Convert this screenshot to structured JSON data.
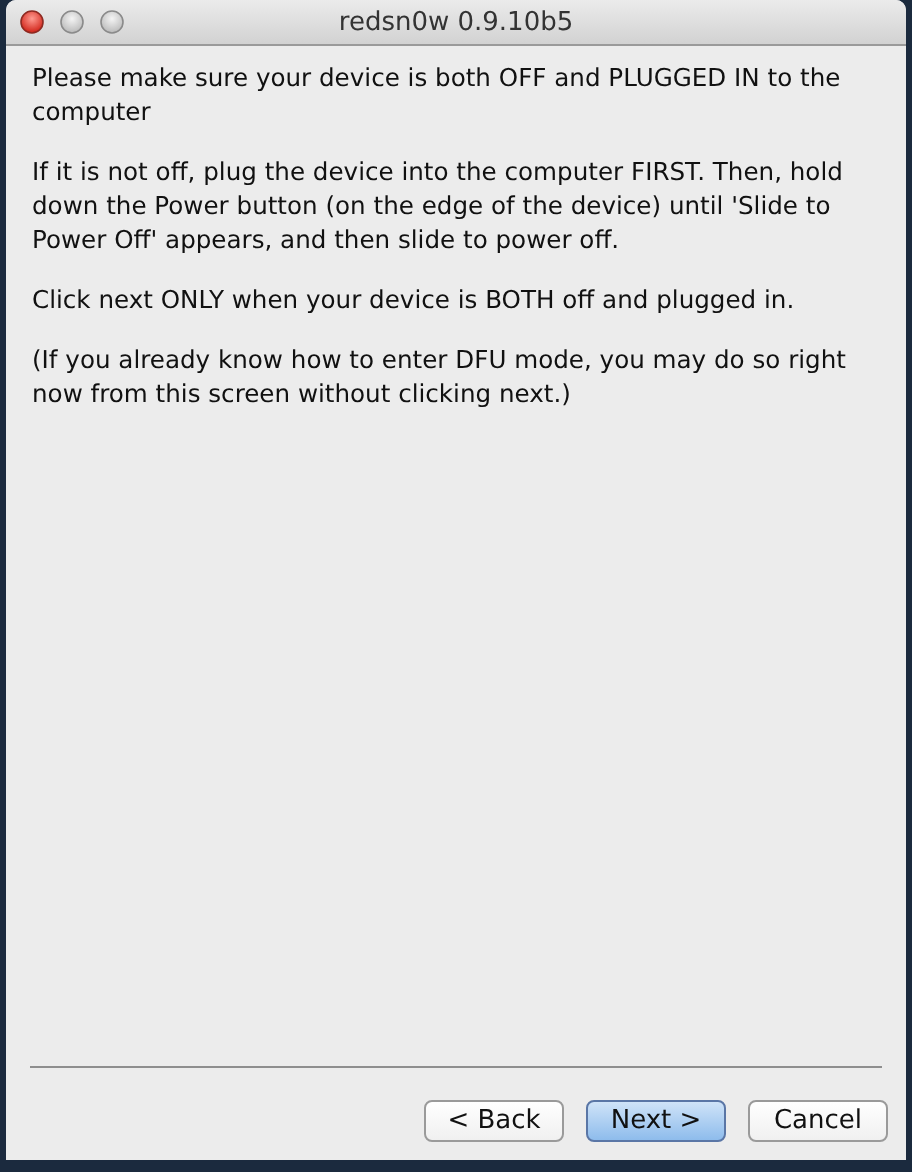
{
  "window": {
    "title": "redsn0w 0.9.10b5"
  },
  "paragraphs": [
    "Please make sure your device is both OFF and PLUGGED IN to the computer",
    "If it is not off, plug the device into the computer FIRST. Then, hold down the Power button (on the edge of the device) until 'Slide to Power Off' appears, and then slide to power off.",
    "Click next ONLY when your device is BOTH off and plugged in.",
    "(If you already know how to enter DFU mode, you may do so right now from this screen without clicking next.)"
  ],
  "buttons": [
    {
      "label": "< Back",
      "default": false
    },
    {
      "label": "Next >",
      "default": true
    },
    {
      "label": "Cancel",
      "default": false
    }
  ]
}
